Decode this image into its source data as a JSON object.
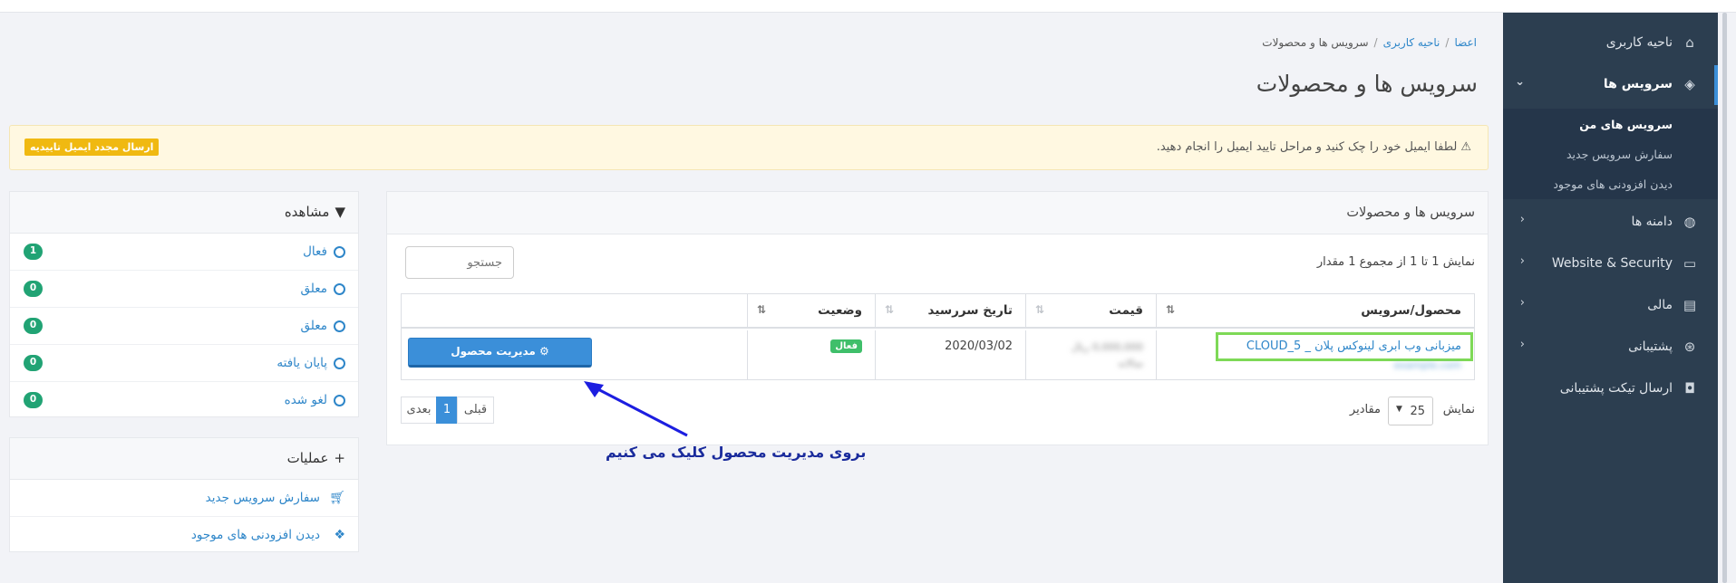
{
  "sidebar": {
    "items": [
      {
        "label": "ناحیه کاربری",
        "icon": "home-icon"
      },
      {
        "label": "سرویس ها",
        "icon": "cube-icon"
      },
      {
        "label": "دامنه ها",
        "icon": "globe-icon"
      },
      {
        "label": "Website & Security",
        "icon": "monitor-icon"
      },
      {
        "label": "مالی",
        "icon": "document-icon"
      },
      {
        "label": "پشتیبانی",
        "icon": "lifebuoy-icon"
      },
      {
        "label": "ارسال تیکت پشتیبانی",
        "icon": "comment-icon"
      }
    ],
    "sub_items": [
      "سرویس های من",
      "سفارش سرویس جدید",
      "دیدن افزودنی های موجود"
    ]
  },
  "breadcrumb": {
    "items": [
      "اعضا",
      "ناحیه کاربری",
      "سرویس ها و محصولات"
    ]
  },
  "page_title": "سرویس ها و محصولات",
  "alert": {
    "text": "لطفا ایمیل خود را چک کنید و مراحل تایید ایمیل را انجام دهید.",
    "button": "ارسال مجدد ایمیل تاییدیه",
    "accent": "#f0b911"
  },
  "panel": {
    "title": "سرویس ها و محصولات",
    "showing": "نمایش 1 تا 1 از مجموع 1 مقدار",
    "search_placeholder": "جستجو",
    "columns": [
      "محصول/سرویس",
      "قیمت",
      "تاریخ سررسید",
      "وضعیت"
    ],
    "rows": [
      {
        "product": "میزبانی وب ابری لینوکس پلان _ CLOUD_5",
        "product_sub": "example.com",
        "price": "0,000,000 ریال",
        "price_cycle": "سالانه",
        "due_date": "2020/03/02",
        "status": "فعال",
        "action": "مدیریت محصول"
      }
    ],
    "pager": {
      "prev": "قبلی",
      "current": "1",
      "next": "بعدی"
    },
    "per_page": {
      "label": "نمایش",
      "value": "25",
      "suffix": "مقادیر"
    }
  },
  "annotation": {
    "text": "بروی مدیریت محصول کلیک  می کنیم",
    "color": "#1a2b9c"
  },
  "filter": {
    "title": "مشاهده",
    "items": [
      {
        "label": "فعال",
        "count": "1"
      },
      {
        "label": "معلق",
        "count": "0"
      },
      {
        "label": "معلق",
        "count": "0"
      },
      {
        "label": "پایان یافته",
        "count": "0"
      },
      {
        "label": "لغو شده",
        "count": "0"
      }
    ]
  },
  "actions": {
    "title": "عملیات",
    "items": [
      {
        "label": "سفارش سرویس جدید",
        "icon": "cart-icon"
      },
      {
        "label": "دیدن افزودنی های موجود",
        "icon": "cubes-icon"
      }
    ]
  }
}
